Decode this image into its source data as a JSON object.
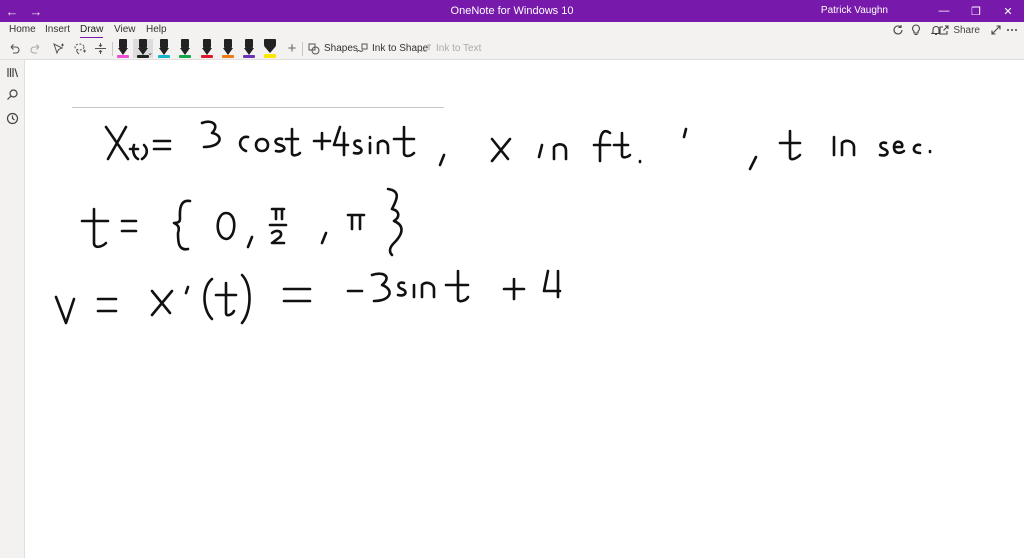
{
  "titlebar": {
    "title": "OneNote for Windows 10",
    "user": "Patrick Vaughn",
    "back_glyph": "←",
    "forward_glyph": "→",
    "minimize_glyph": "—",
    "restore_glyph": "❐",
    "close_glyph": "✕"
  },
  "tabs": [
    {
      "label": "Home"
    },
    {
      "label": "Insert"
    },
    {
      "label": "Draw"
    },
    {
      "label": "View"
    },
    {
      "label": "Help"
    }
  ],
  "right_tools": {
    "share_label": "Share"
  },
  "ribbon": {
    "shapes_label": "Shapes",
    "ink_to_shape_label": "Ink to Shape",
    "ink_to_text_label": "Ink to Text"
  },
  "pens": [
    {
      "name": "pen-black-pink",
      "color": "#ec4fd6"
    },
    {
      "name": "pen-black",
      "color": "#222222"
    },
    {
      "name": "pen-teal",
      "color": "#12b5cb"
    },
    {
      "name": "pen-green",
      "color": "#10a84b"
    },
    {
      "name": "pen-red",
      "color": "#e0182d"
    },
    {
      "name": "pen-orange",
      "color": "#f07b12"
    },
    {
      "name": "pen-purple",
      "color": "#6a33b8"
    },
    {
      "name": "highlighter-yellow",
      "color": "#ffe600"
    }
  ],
  "colors": {
    "accent": "#7719aa"
  }
}
